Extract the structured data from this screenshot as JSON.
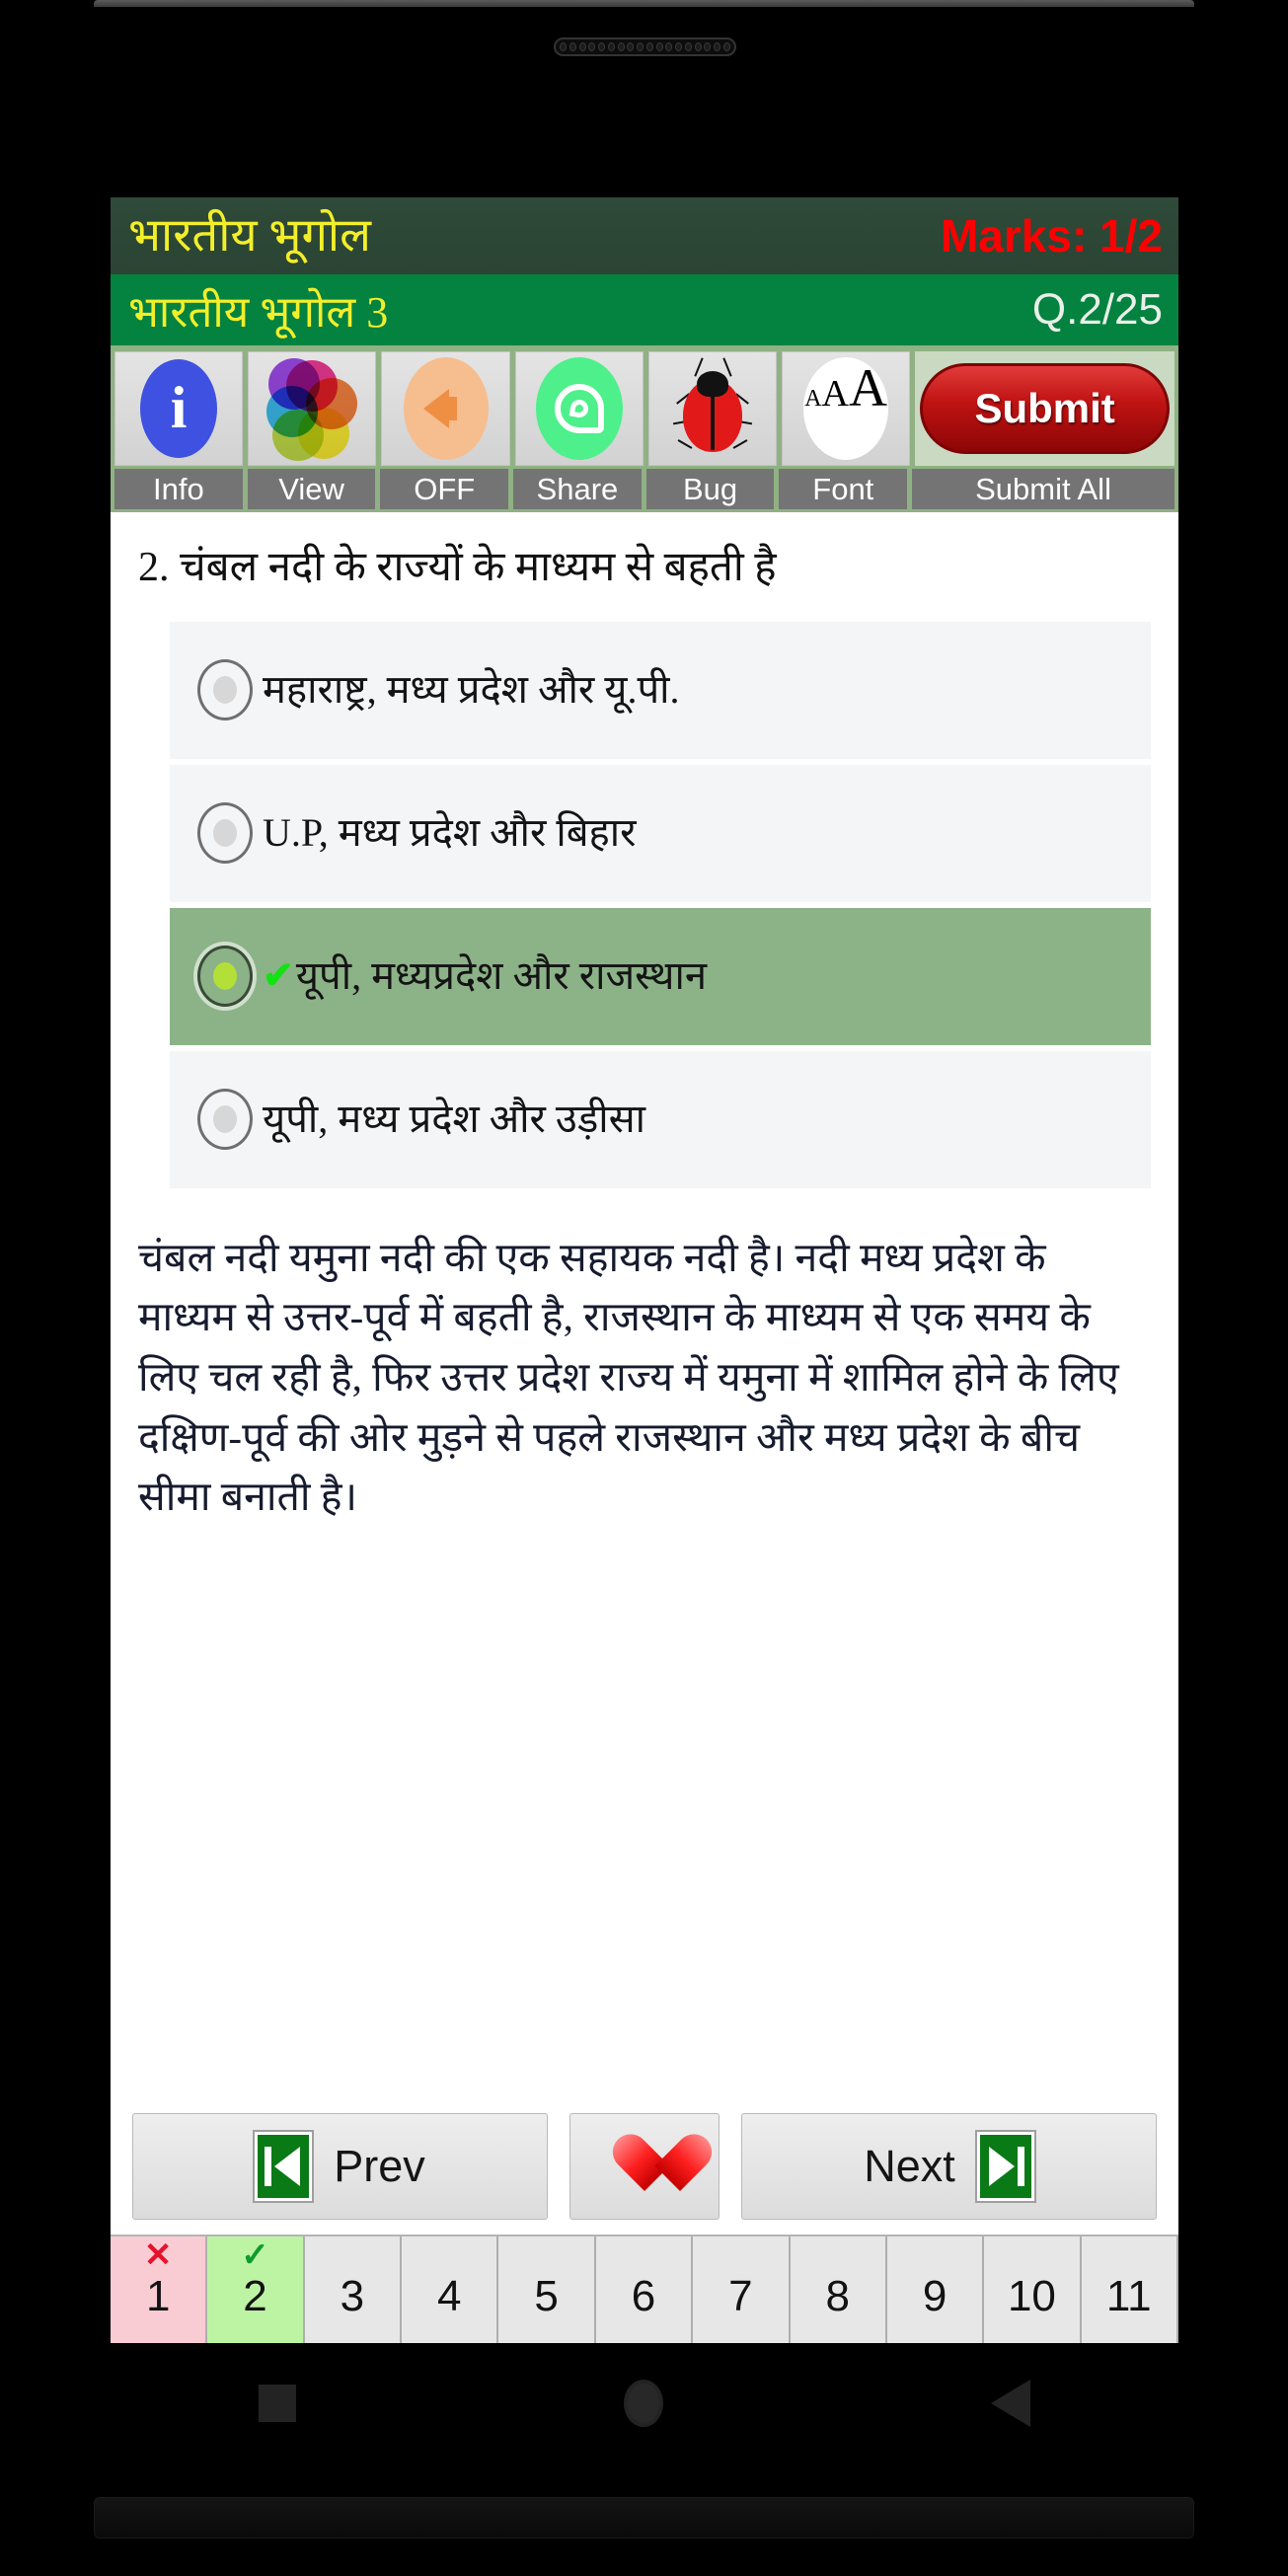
{
  "device": {
    "earpiece": "speaker-grille",
    "nav": {
      "recents": "recents-square-icon",
      "home": "home-circle-icon",
      "back": "back-triangle-icon"
    }
  },
  "header": {
    "app_title": "भारतीय भूगोल",
    "marks": "Marks: 1/2",
    "quiz_set": "भारतीय भूगोल 3",
    "question_counter": "Q.2/25"
  },
  "toolbar": {
    "items": [
      {
        "label": "Info",
        "icon": "info-icon"
      },
      {
        "label": "View",
        "icon": "color-wheel-icon"
      },
      {
        "label": "OFF",
        "icon": "speaker-icon"
      },
      {
        "label": "Share",
        "icon": "whatsapp-icon"
      },
      {
        "label": "Bug",
        "icon": "ladybug-icon"
      },
      {
        "label": "Font",
        "icon": "font-size-icon"
      },
      {
        "label": "Submit All",
        "icon": "submit-pill-icon"
      }
    ],
    "submit_label": "Submit",
    "font_icon_text": {
      "small": "A",
      "medium": "A",
      "large": "A"
    }
  },
  "question": {
    "number": "2.",
    "text": "2. चंबल नदी के राज्यों के माध्यम से बहती है",
    "options": [
      {
        "text": "महाराष्ट्र, मध्य प्रदेश और यू.पी.",
        "selected": false,
        "correct": false
      },
      {
        "text": "U.P, मध्य प्रदेश और बिहार",
        "selected": false,
        "correct": false
      },
      {
        "text": "यूपी, मध्यप्रदेश और राजस्थान",
        "selected": true,
        "correct": true
      },
      {
        "text": "यूपी, मध्य प्रदेश और उड़ीसा",
        "selected": false,
        "correct": false
      }
    ],
    "correct_mark": "✔",
    "explanation": "चंबल नदी यमुना नदी की एक सहायक नदी है। नदी मध्य प्रदेश के माध्यम से उत्तर-पूर्व में बहती है, राजस्थान के माध्यम से एक समय के लिए चल रही है, फिर उत्तर प्रदेश राज्य में यमुना में शामिल होने के लिए दक्षिण-पूर्व की ओर मुड़ने से पहले राजस्थान और मध्य प्रदेश के बीच सीमा बनाती है।"
  },
  "footer": {
    "prev_label": "Prev",
    "next_label": "Next",
    "favorite_icon": "heart-icon",
    "prev_icon": "skip-to-first-icon",
    "next_icon": "skip-to-last-icon"
  },
  "question_strip": {
    "cells": [
      {
        "number": "1",
        "state": "wrong",
        "mark": "✕"
      },
      {
        "number": "2",
        "state": "correct",
        "mark": "✓"
      },
      {
        "number": "3",
        "state": "none",
        "mark": ""
      },
      {
        "number": "4",
        "state": "none",
        "mark": ""
      },
      {
        "number": "5",
        "state": "none",
        "mark": ""
      },
      {
        "number": "6",
        "state": "none",
        "mark": ""
      },
      {
        "number": "7",
        "state": "none",
        "mark": ""
      },
      {
        "number": "8",
        "state": "none",
        "mark": ""
      },
      {
        "number": "9",
        "state": "none",
        "mark": ""
      },
      {
        "number": "10",
        "state": "none",
        "mark": ""
      },
      {
        "number": "11",
        "state": "none",
        "mark": ""
      }
    ]
  },
  "colors": {
    "title_bar": "#2f4a38",
    "subtitle_bar": "#048240",
    "title_text": "#f2ef2a",
    "marks_text": "#ff0000",
    "toolbar_bg": "#8fb183",
    "tool_label_bg": "#747474",
    "selected_option_bg": "#8cb288",
    "submit_red": "#c01313",
    "correct_green": "#bdf4a4",
    "wrong_pink": "#f9ccd3"
  }
}
